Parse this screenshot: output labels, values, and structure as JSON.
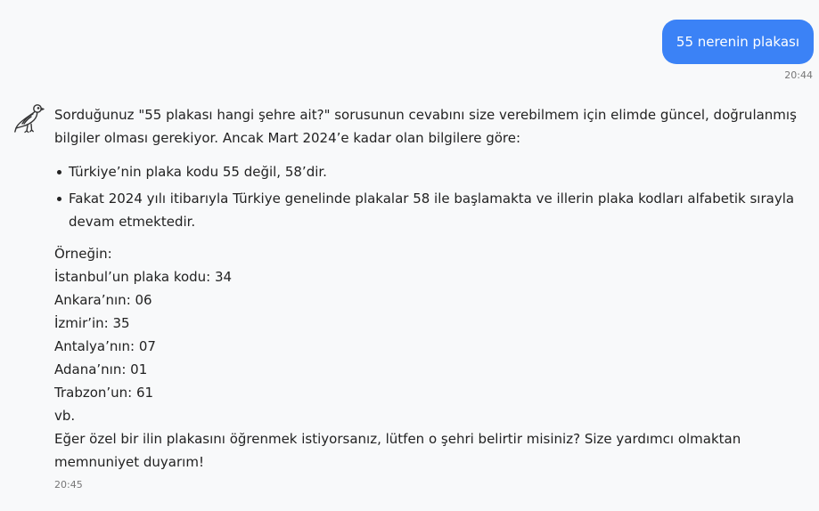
{
  "user_message": {
    "text": "55 nerenin plakası",
    "time": "20:44"
  },
  "bot_message": {
    "avatar_icon": "bird-icon",
    "intro": "Sorduğunuz \"55 plakası hangi şehre ait?\" sorusunun cevabını size verebilmem için elimde güncel, doğrulanmış bilgiler olması gerekiyor. Ancak Mart 2024’e kadar olan bilgilere göre:",
    "bullets": [
      "Türkiye’nin plaka kodu 55 değil, 58’dir.",
      "Fakat 2024 yılı itibarıyla Türkiye genelinde plakalar 58 ile başlamakta ve illerin plaka kodları alfabetik sırayla devam etmektedir."
    ],
    "examples": [
      "Örneğin:",
      "İstanbul’un plaka kodu: 34",
      "Ankara’nın: 06",
      "İzmir’in: 35",
      "Antalya’nın: 07",
      "Adana’nın: 01",
      "Trabzon’un: 61",
      "vb."
    ],
    "closing": "Eğer özel bir ilin plakasını öğrenmek istiyorsanız, lütfen o şehri belirtir misiniz? Size yardımcı olmaktan memnuniyet duyarım!",
    "time": "20:45"
  },
  "colors": {
    "user_bubble": "#3b82f6",
    "background": "#f8f9fa",
    "text": "#222222",
    "timestamp": "#777777"
  }
}
